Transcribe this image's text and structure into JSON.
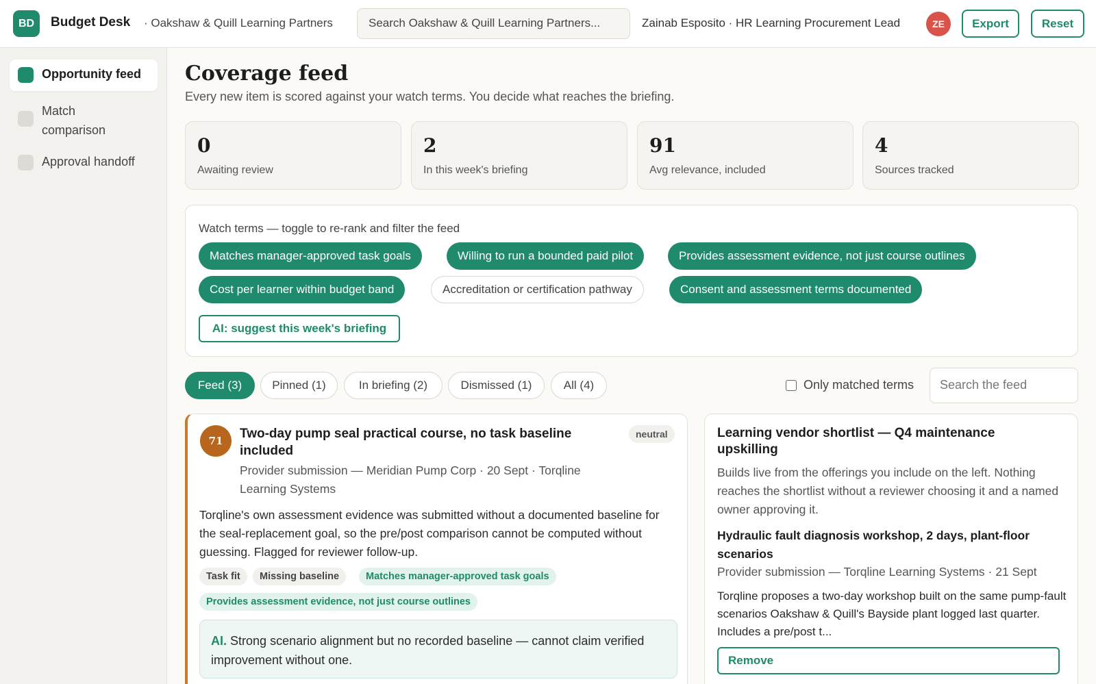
{
  "header": {
    "logo_text": "BD",
    "app_name": "Budget Desk",
    "org": "· Oakshaw & Quill Learning Partners",
    "search_placeholder": "Search Oakshaw & Quill Learning Partners...",
    "user": "Zainab Esposito · HR Learning Procurement Lead",
    "avatar_initials": "ZE",
    "export_label": "Export",
    "reset_label": "Reset"
  },
  "sidebar": {
    "items": [
      {
        "label": "Opportunity feed",
        "active": true
      },
      {
        "label": "Match comparison",
        "active": false
      },
      {
        "label": "Approval handoff",
        "active": false
      }
    ]
  },
  "main": {
    "title": "Coverage feed",
    "subtitle": "Every new item is scored against your watch terms. You decide what reaches the briefing."
  },
  "stats": [
    {
      "value": "0",
      "label": "Awaiting review"
    },
    {
      "value": "2",
      "label": "In this week's briefing"
    },
    {
      "value": "91",
      "label": "Avg relevance, included"
    },
    {
      "value": "4",
      "label": "Sources tracked"
    }
  ],
  "watch": {
    "heading": "Watch terms — toggle to re-rank and filter the feed",
    "terms": [
      {
        "label": "Matches manager-approved task goals",
        "on": true
      },
      {
        "label": "Willing to run a bounded paid pilot",
        "on": true
      },
      {
        "label": "Provides assessment evidence, not just course outlines",
        "on": true
      },
      {
        "label": "Cost per learner within budget band",
        "on": true
      },
      {
        "label": "Accreditation or certification pathway",
        "on": false
      },
      {
        "label": "Consent and assessment terms documented",
        "on": true
      }
    ],
    "ai_button": "AI: suggest this week's briefing"
  },
  "tabs": [
    {
      "label": "Feed (3)",
      "active": true
    },
    {
      "label": "Pinned (1)",
      "active": false
    },
    {
      "label": "In briefing (2)",
      "active": false
    },
    {
      "label": "Dismissed (1)",
      "active": false
    },
    {
      "label": "All (4)",
      "active": false
    }
  ],
  "filters": {
    "only_matched_label": "Only matched terms",
    "only_matched_checked": false,
    "search_placeholder": "Search the feed"
  },
  "feed_item": {
    "score": "71",
    "title": "Two-day pump seal practical course, no task baseline included",
    "sentiment": "neutral",
    "meta": "Provider submission — Meridian Pump Corp · 20 Sept · Torqline Learning Systems",
    "body": "Torqline's own assessment evidence was submitted without a documented baseline for the seal-replacement goal, so the pre/post comparison cannot be computed without guessing. Flagged for reviewer follow-up.",
    "tags": [
      {
        "label": "Task fit",
        "style": "grey"
      },
      {
        "label": "Missing baseline",
        "style": "grey"
      },
      {
        "label": "Matches manager-approved task goals",
        "style": "green"
      },
      {
        "label": "Provides assessment evidence, not just course outlines",
        "style": "green"
      }
    ],
    "ai_label": "AI.",
    "ai_text": "Strong scenario alignment but no recorded baseline — cannot claim verified improvement without one."
  },
  "shortlist": {
    "title": "Learning vendor shortlist — Q4 maintenance upskilling",
    "description": "Builds live from the offerings you include on the left. Nothing reaches the shortlist without a reviewer choosing it and a named owner approving it.",
    "item": {
      "title": "Hydraulic fault diagnosis workshop, 2 days, plant-floor scenarios",
      "meta": "Provider submission — Torqline Learning Systems · 21 Sept",
      "body": "Torqline proposes a two-day workshop built on the same pump-fault scenarios Oakshaw & Quill's Bayside plant logged last quarter. Includes a pre/post t...",
      "remove_label": "Remove"
    }
  },
  "colors": {
    "accent": "#1f8a6c",
    "avatar": "#d9534a",
    "score_badge": "#b8651d",
    "card_border": "#c97a2a"
  }
}
